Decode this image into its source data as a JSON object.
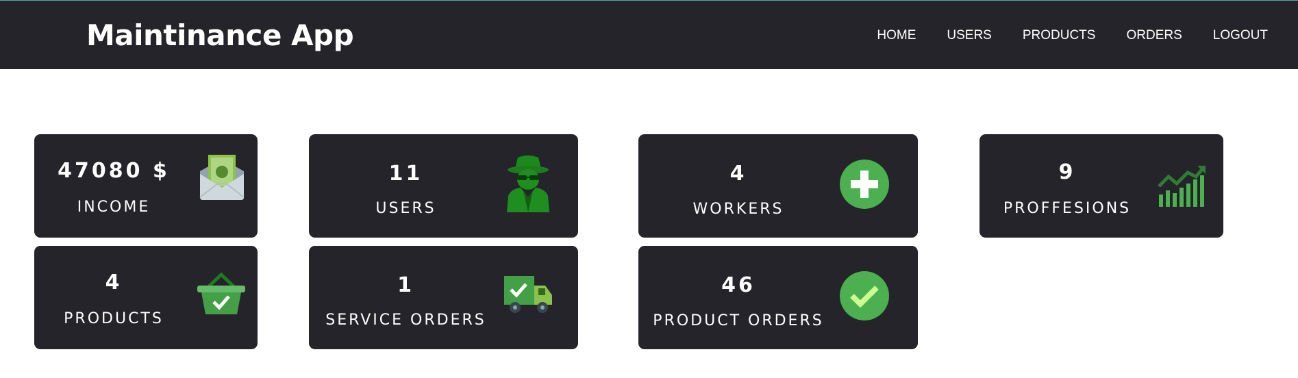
{
  "app": {
    "title": "Maintinance App"
  },
  "nav": [
    {
      "label": "HOME"
    },
    {
      "label": "USERS"
    },
    {
      "label": "PRODUCTS"
    },
    {
      "label": "ORDERS"
    },
    {
      "label": "LOGOUT"
    }
  ],
  "cards": {
    "income": {
      "value": "47080 $",
      "label": "INCOME",
      "icon": "money-envelope-icon"
    },
    "users": {
      "value": "11",
      "label": "USERS",
      "icon": "spy-icon"
    },
    "workers": {
      "value": "4",
      "label": "WORKERS",
      "icon": "plus-circle-icon"
    },
    "proffesions": {
      "value": "9",
      "label": "PROFFESIONS",
      "icon": "growth-chart-icon"
    },
    "products": {
      "value": "4",
      "label": "PRODUCTS",
      "icon": "basket-check-icon"
    },
    "service_orders": {
      "value": "1",
      "label": "SERVICE ORDERS",
      "icon": "delivery-truck-icon"
    },
    "product_orders": {
      "value": "46",
      "label": "PRODUCT ORDERS",
      "icon": "check-circle-icon"
    }
  },
  "colors": {
    "navbar": "#25242b",
    "card": "#25242b",
    "accent_green": "#4caf50",
    "dark_green": "#1e7b1e",
    "light_green": "#8bc34a"
  }
}
